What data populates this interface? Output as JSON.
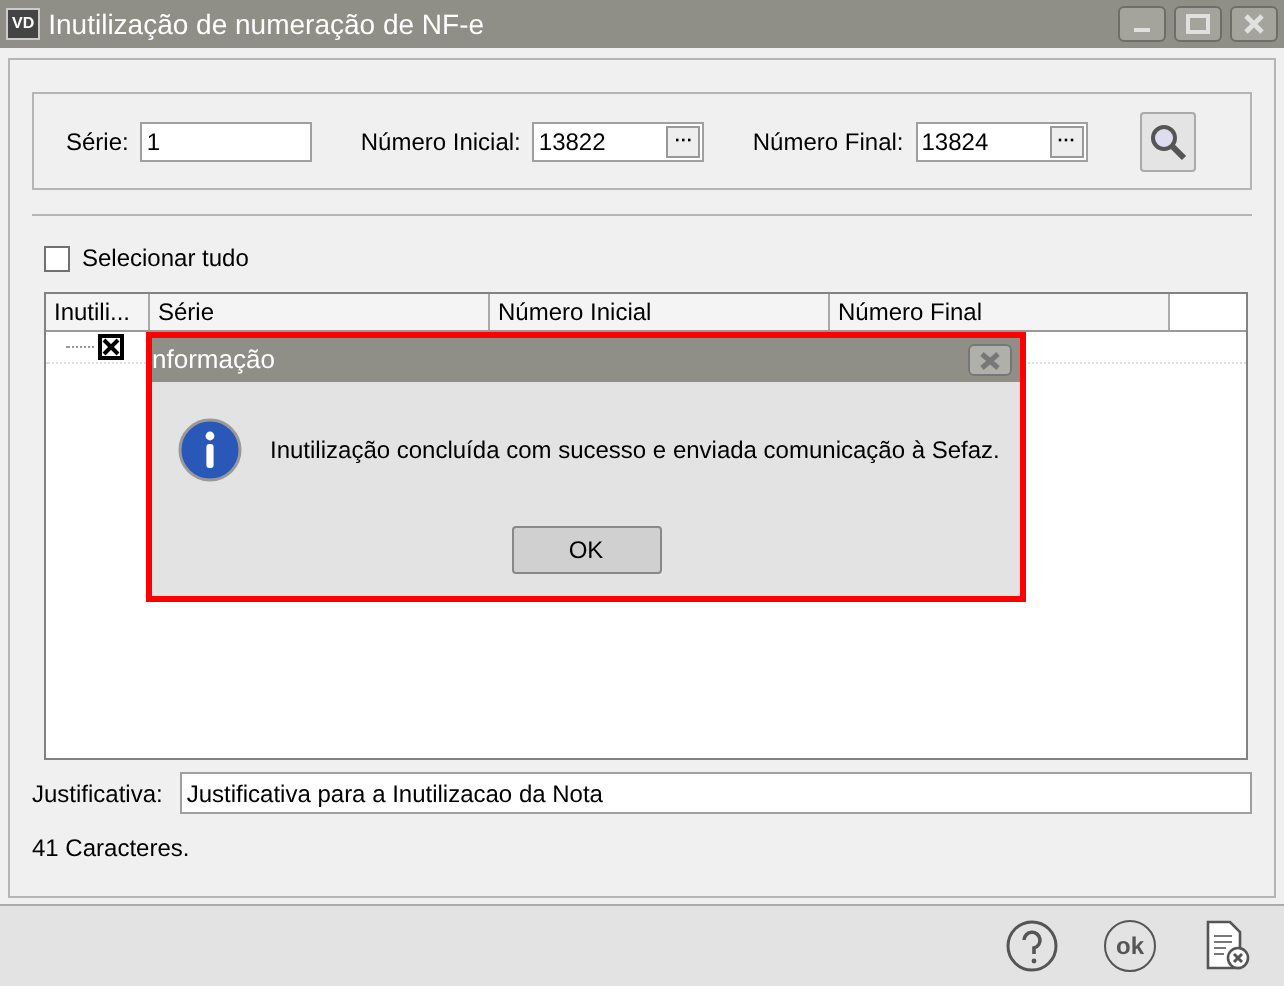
{
  "window": {
    "app_badge": "VD",
    "title": "Inutilização de numeração de NF-e"
  },
  "filters": [
    {
      "label": "Série:",
      "value": "1",
      "kind": "text"
    },
    {
      "label": "Número Inicial:",
      "value": "13822",
      "kind": "lookup",
      "button": "···"
    },
    {
      "label": "Número Final:",
      "value": "13824",
      "kind": "lookup",
      "button": "···"
    }
  ],
  "select_all": {
    "label": "Selecionar tudo",
    "checked": false
  },
  "table": {
    "columns": [
      "Inutili...",
      "Série",
      "Número Inicial",
      "Número Final"
    ],
    "rows": [
      {
        "checked": true
      }
    ]
  },
  "justificativa": {
    "label": "Justificativa:",
    "value": "Justificativa para a Inutilizacao da Nota"
  },
  "char_count": "41 Caracteres.",
  "footer": {
    "ok_label": "ok"
  },
  "dialog": {
    "title": "nformação",
    "message": "Inutilização concluída com sucesso e enviada comunicação à Sefaz.",
    "button": "OK"
  }
}
